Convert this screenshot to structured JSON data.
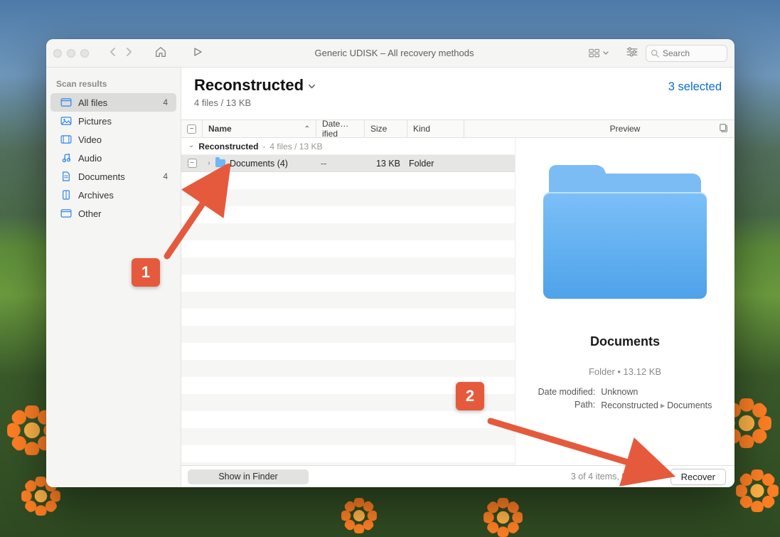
{
  "window_title": "Generic UDISK – All recovery methods",
  "search_placeholder": "Search",
  "sidebar": {
    "header": "Scan results",
    "items": [
      {
        "label": "All files",
        "badge": "4"
      },
      {
        "label": "Pictures",
        "badge": ""
      },
      {
        "label": "Video",
        "badge": ""
      },
      {
        "label": "Audio",
        "badge": ""
      },
      {
        "label": "Documents",
        "badge": "4"
      },
      {
        "label": "Archives",
        "badge": ""
      },
      {
        "label": "Other",
        "badge": ""
      }
    ]
  },
  "header": {
    "title": "Reconstructed",
    "subtitle": "4 files / 13 KB",
    "selected": "3 selected"
  },
  "columns": {
    "name": "Name",
    "date": "Date…ified",
    "size": "Size",
    "kind": "Kind",
    "preview": "Preview"
  },
  "group": {
    "name": "Reconstructed",
    "sep": " - ",
    "details": "4 files / 13 KB"
  },
  "row": {
    "name": "Documents (4)",
    "date": "--",
    "size": "13 KB",
    "kind": "Folder"
  },
  "preview": {
    "title": "Documents",
    "subline": "Folder • 13.12 KB",
    "date_k": "Date modified:",
    "date_v": "Unknown",
    "path_k": "Path:",
    "path_a": "Reconstructed",
    "path_b": "Documents"
  },
  "footer": {
    "show": "Show in Finder",
    "status": "3 of 4 items, 9 KB total",
    "recover": "Recover"
  },
  "callouts": {
    "one": "1",
    "two": "2"
  }
}
